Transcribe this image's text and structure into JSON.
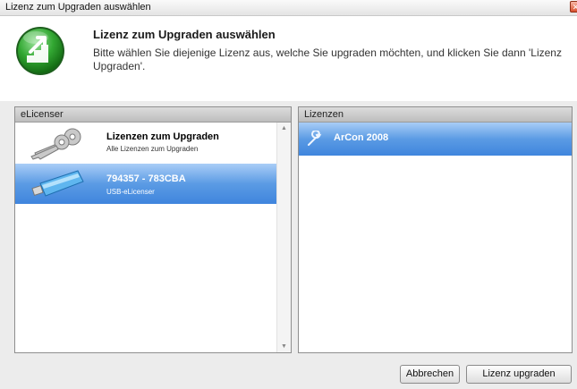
{
  "window": {
    "title": "Lizenz zum Upgraden auswählen"
  },
  "header": {
    "heading": "Lizenz zum Upgraden auswählen",
    "description": "Bitte wählen Sie diejenige Lizenz aus, welche Sie upgraden möchten, und klicken Sie dann 'Lizenz Upgraden'."
  },
  "elicenser": {
    "header": "eLicenser",
    "items": [
      {
        "title": "Lizenzen zum Upgraden",
        "subtitle": "Alle Lizenzen zum Upgraden",
        "icon": "keys-icon",
        "selected": false
      },
      {
        "title": "794357 - 783CBA",
        "subtitle": "USB-eLicenser",
        "icon": "usb-stick-icon",
        "selected": true
      }
    ]
  },
  "licenses": {
    "header": "Lizenzen",
    "items": [
      {
        "title": "ArCon 2008",
        "icon": "wrench-icon",
        "selected": true
      }
    ]
  },
  "buttons": {
    "cancel": "Abbrechen",
    "upgrade": "Lizenz upgraden"
  },
  "colors": {
    "selection": "#4a8fe0",
    "logo_green": "#2fa32f"
  }
}
